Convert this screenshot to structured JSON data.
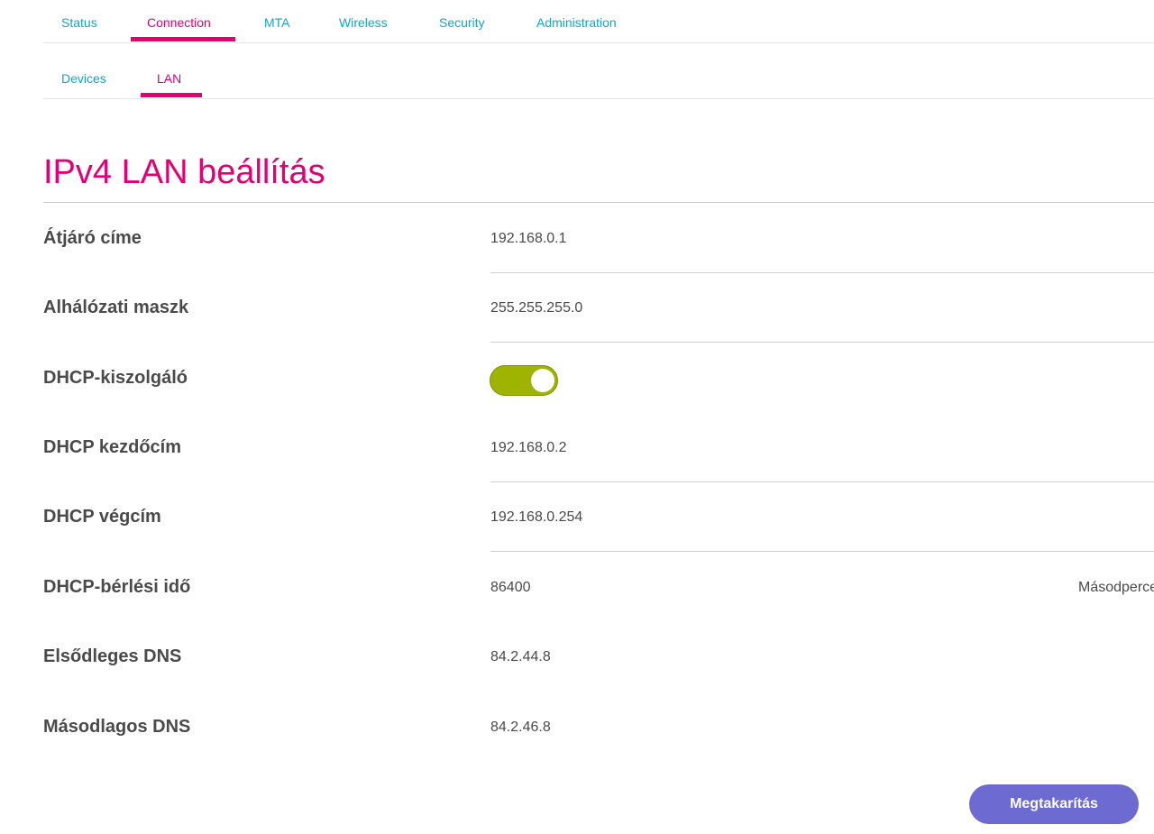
{
  "nav": {
    "tabs": [
      "Status",
      "Connection",
      "MTA",
      "Wireless",
      "Security",
      "Administration"
    ],
    "active_tab": "Connection"
  },
  "subnav": {
    "tabs": [
      "Devices",
      "LAN"
    ],
    "active_tab": "LAN"
  },
  "page_title": "IPv4 LAN beállítás",
  "settings": [
    {
      "label": "Átjáró címe",
      "value": "192.168.0.1"
    },
    {
      "label": "Alhálózati maszk",
      "value": "255.255.255.0"
    },
    {
      "label": "DHCP-kiszolgáló",
      "toggle_on": true
    },
    {
      "label": "DHCP kezdőcím",
      "value": "192.168.0.2"
    },
    {
      "label": "DHCP végcím",
      "value": "192.168.0.254"
    },
    {
      "label": "DHCP-bérlési idő",
      "value": "86400",
      "unit": "Másodpercek"
    },
    {
      "label": "Elsődleges DNS",
      "value": "84.2.44.8"
    },
    {
      "label": "Másodlagos DNS",
      "value": "84.2.46.8"
    }
  ],
  "save_label": "Megtakarítás",
  "colors": {
    "accent": "#e20074",
    "link": "#11a6c4",
    "toggle_on": "#9fb400",
    "button": "#6d6ad2"
  }
}
